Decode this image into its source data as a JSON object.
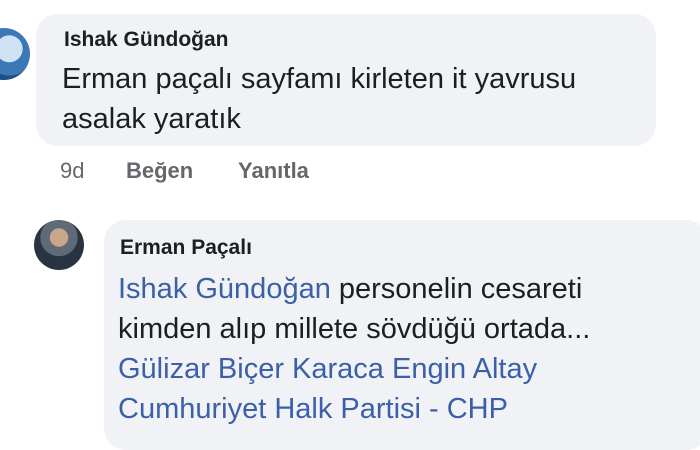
{
  "comment": {
    "author": "Ishak Gündoğan",
    "text_line1": "Erman paçalı sayfamı kirleten it yavrusu",
    "text_line2": "asalak yaratık",
    "time": "9d",
    "like_label": "Beğen",
    "reply_label": "Yanıtla"
  },
  "reply": {
    "author": "Erman Paçalı",
    "mention": "Ishak Gündoğan",
    "text_line1_rest": "personelin cesareti",
    "text_line2": "kimden alıp millete sövdüğü ortada...",
    "mentions_line3": "Gülizar Biçer Karaca Engin Altay",
    "mentions_line4": "Cumhuriyet Halk Partisi - CHP"
  }
}
